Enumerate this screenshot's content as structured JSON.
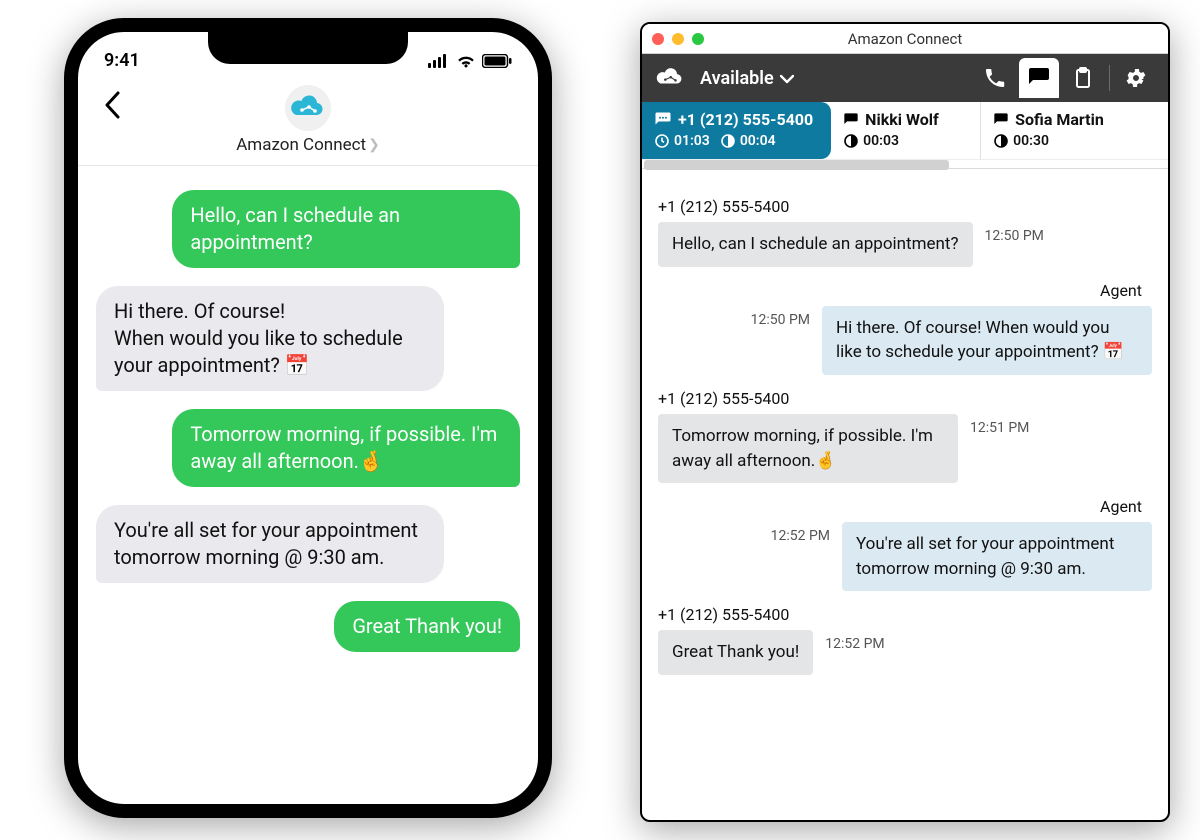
{
  "phone": {
    "status_time": "9:41",
    "header_title": "Amazon Connect",
    "messages": [
      {
        "side": "sent",
        "text": "Hello, can I schedule an appointment?"
      },
      {
        "side": "recv",
        "text": "Hi there. Of course!\nWhen would you like to schedule your appointment? 📅"
      },
      {
        "side": "sent",
        "text": "Tomorrow morning, if possible. I'm away all afternoon.🤞"
      },
      {
        "side": "recv",
        "text": "You're all set for your appointment tomorrow morning @ 9:30 am."
      },
      {
        "side": "sent",
        "text": "Great Thank you!"
      }
    ]
  },
  "desktop": {
    "window_title": "Amazon Connect",
    "agent_status": "Available",
    "tabs": [
      {
        "label": "+1 (212) 555-5400",
        "clock": "01:03",
        "idle": "00:04",
        "active": true
      },
      {
        "label": "Nikki Wolf",
        "clock": "",
        "idle": "00:03",
        "active": false
      },
      {
        "label": "Sofia Martin",
        "clock": "",
        "idle": "00:30",
        "active": false
      }
    ],
    "messages": [
      {
        "sender": "+1 (212) 555-5400",
        "dir": "in",
        "text": "Hello, can I schedule an appointment?",
        "time": "12:50 PM"
      },
      {
        "sender": "Agent",
        "dir": "out",
        "text": "Hi there. Of course! When would you like to schedule your appointment? 📅",
        "time": "12:50 PM"
      },
      {
        "sender": "+1 (212) 555-5400",
        "dir": "in",
        "text": "Tomorrow morning, if possible. I'm away all afternoon.🤞",
        "time": "12:51 PM"
      },
      {
        "sender": "Agent",
        "dir": "out",
        "text": "You're all set for your appointment tomorrow morning @ 9:30 am.",
        "time": "12:52 PM"
      },
      {
        "sender": "+1 (212) 555-5400",
        "dir": "in",
        "text": "Great Thank you!",
        "time": "12:52 PM"
      }
    ]
  }
}
